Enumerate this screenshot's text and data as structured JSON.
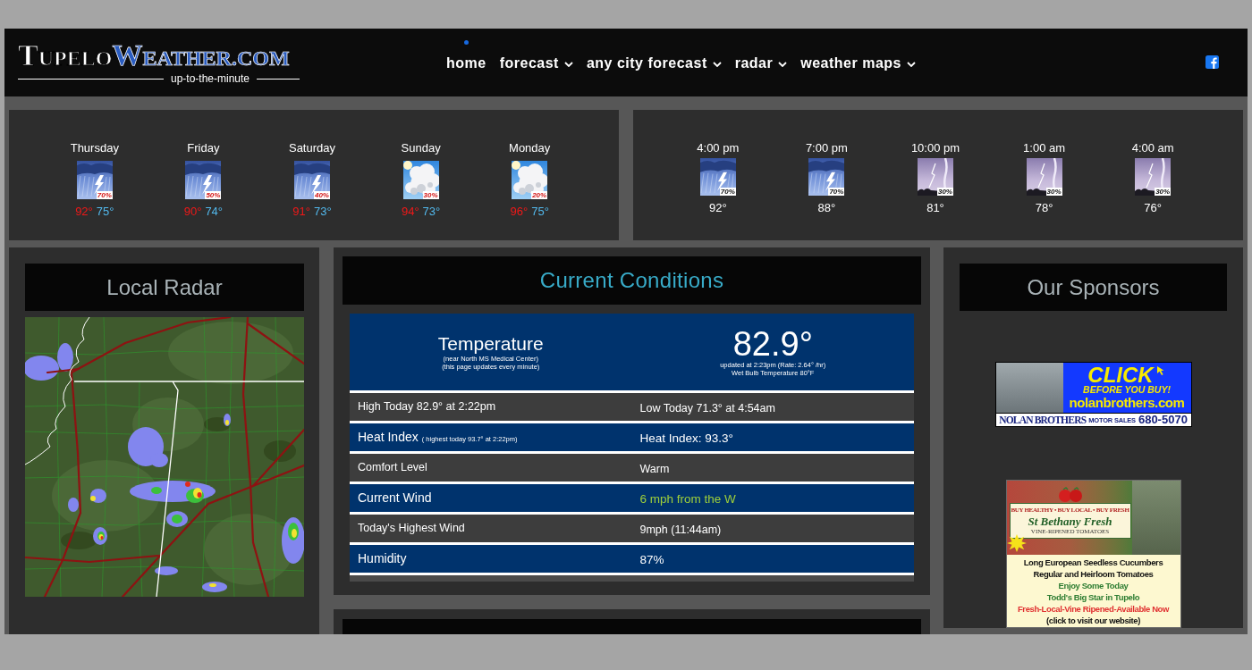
{
  "header": {
    "logo": {
      "first": "TUPELO",
      "second": "WEATHER.COM",
      "tagline": "up-to-the-minute"
    },
    "nav": [
      {
        "label": "home",
        "selected": true,
        "has_menu": false
      },
      {
        "label": "forecast",
        "selected": false,
        "has_menu": true
      },
      {
        "label": "any city forecast",
        "selected": false,
        "has_menu": true
      },
      {
        "label": "radar",
        "selected": false,
        "has_menu": true
      },
      {
        "label": "weather maps",
        "selected": false,
        "has_menu": true
      }
    ]
  },
  "daily_forecast": [
    {
      "day": "Thursday",
      "kind": "storm",
      "chance": "70%",
      "high": "92°",
      "low": "75°"
    },
    {
      "day": "Friday",
      "kind": "storm",
      "chance": "50%",
      "high": "90°",
      "low": "74°"
    },
    {
      "day": "Saturday",
      "kind": "storm",
      "chance": "40%",
      "high": "91°",
      "low": "73°"
    },
    {
      "day": "Sunday",
      "kind": "cloud",
      "chance": "30%",
      "high": "94°",
      "low": "73°"
    },
    {
      "day": "Monday",
      "kind": "cloud",
      "chance": "20%",
      "high": "96°",
      "low": "75°"
    }
  ],
  "hourly_forecast": [
    {
      "time": "4:00 pm",
      "kind": "storm",
      "chance": "70%",
      "temp": "92°"
    },
    {
      "time": "7:00 pm",
      "kind": "storm",
      "chance": "70%",
      "temp": "88°"
    },
    {
      "time": "10:00 pm",
      "kind": "lightning",
      "chance": "30%",
      "temp": "81°"
    },
    {
      "time": "1:00 am",
      "kind": "lightning",
      "chance": "30%",
      "temp": "78°"
    },
    {
      "time": "4:00 am",
      "kind": "lightning",
      "chance": "30%",
      "temp": "76°"
    }
  ],
  "radar": {
    "title": "Local Radar"
  },
  "current_conditions": {
    "title": "Current Conditions",
    "temperature": {
      "label": "Temperature",
      "notes": [
        "(near North MS Medical Center)",
        "(this page updates every minute)"
      ],
      "value": "82.9°",
      "details": [
        "updated at 2:23pm (Rate: 2.64° /hr)",
        "Wet Bulb Temperature 80°F"
      ]
    },
    "rows": [
      {
        "label": "High Today 82.9° at 2:22pm",
        "value": "Low Today 71.3° at 4:54am",
        "highlight": false
      },
      {
        "label": "Heat Index",
        "note": "( highest today 93.7° at 2:22pm)",
        "value": "Heat Index: 93.3°",
        "highlight": false
      },
      {
        "label": "Comfort Level",
        "value": "Warm",
        "highlight": false
      },
      {
        "label": "Current Wind",
        "value": "6 mph from the W",
        "highlight": true
      },
      {
        "label": "Today's Highest Wind",
        "value": "9mph (11:44am)",
        "highlight": false
      },
      {
        "label": "Humidity",
        "value": "87%",
        "highlight": false
      }
    ]
  },
  "sponsors": {
    "title": "Our Sponsors",
    "ads": [
      {
        "kind": "dealer",
        "headline": "CLICK",
        "tagline": "BEFORE YOU BUY!",
        "website": "nolanbrothers.com",
        "name": "NOLAN BROTHERS",
        "subtitle": "MOTOR SALES",
        "phone": "680-5070"
      },
      {
        "kind": "farm",
        "slogan": "BUY HEALTHY • BUY LOCAL • BUY FRESH",
        "name": "St Bethany Fresh",
        "subtitle": "VINE-RIPENED TOMATOES",
        "lines": [
          {
            "text": "Long European Seedless Cucumbers",
            "color": "#111111"
          },
          {
            "text": "Regular and Heirloom Tomatoes",
            "color": "#111111"
          },
          {
            "text": "Enjoy Some Today",
            "color": "#2e7d32"
          },
          {
            "text": "Todd's Big Star in Tupelo",
            "color": "#2e7d32"
          },
          {
            "text": "Fresh-Local-Vine Ripened-Available Now",
            "color": "#e03030"
          },
          {
            "text": "(click to visit our website)",
            "color": "#111111"
          }
        ]
      }
    ]
  }
}
